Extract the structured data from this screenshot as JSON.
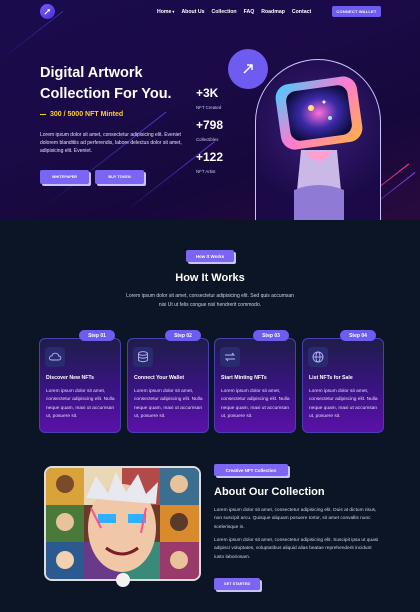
{
  "nav": {
    "links": [
      "Home",
      "About Us",
      "Collection",
      "FAQ",
      "Roadmap",
      "Contact"
    ],
    "connect_label": "CONNECT WALLET"
  },
  "hero": {
    "title": "Digital Artwork Collection For You.",
    "minted": "300 / 5000 NFT Minted",
    "description": "Lorem ipsum dolor sit amet, consectetur adipisicing elit. Eveniet dolorem blanditiis ad perferendis, labore delectus dolor sit amet, adipisicing elit. Eveniet.",
    "btn_whitepaper": "WHITEPAPER",
    "btn_buy": "BUY TOKEN",
    "stats": [
      {
        "value": "+3K",
        "label": "NFT Created"
      },
      {
        "value": "+798",
        "label": "Collectibles"
      },
      {
        "value": "+122",
        "label": "NFT Artist"
      }
    ]
  },
  "how": {
    "pill": "How It Works",
    "title": "How It Works",
    "description": "Lorem ipsum dolor sit amet, consectetur adipisicing elit. Sed quis accumsan nisi Ut ut felis congue nisl hendrerit commodo.",
    "steps": [
      {
        "step": "Step 01",
        "title": "Discover New NFTs",
        "icon": "cloud-icon",
        "desc": "Lorem ipsum dolor sit amet, consectetur adipiscing elit. Nulla neque quam, maxi ut accumsan ut, posuere sit."
      },
      {
        "step": "Step 02",
        "title": "Connect Your Wallet",
        "icon": "database-icon",
        "desc": "Lorem ipsum dolor sit amet, consectetur adipiscing elit. Nulla neque quam, maxi ut accumsan ut, posuere sit."
      },
      {
        "step": "Step 03",
        "title": "Start Minting NFTs",
        "icon": "exchange-icon",
        "desc": "Lorem ipsum dolor sit amet, consectetur adipiscing elit. Nulla neque quam, maxi ut accumsan ut, posuere sit."
      },
      {
        "step": "Step 04",
        "title": "List NFTs for Sale",
        "icon": "globe-icon",
        "desc": "Lorem ipsum dolor sit amet, consectetur adipiscing elit. Nulla neque quam, maxi ut accumsan ut, posuere sit."
      }
    ]
  },
  "about": {
    "pill": "Creative NFT Collection",
    "title": "About Our Collection",
    "p1": "Lorem ipsum dolor sit amet, consectetur adipisicing elit. Duis at dictum risus, non suscipit arcu. Quisque aliquam posuere tortor, sit amet convallis nunc scelerisque in.",
    "p2": "Lorem ipsum dolor sit amet, consectetur adipisicing elit. Suscipit ipsa ut quasi adipisci voluptates, voluptatibus aliquid alias beatae reprehenderit incidunt iusto laboriosam.",
    "btn": "GET STARTED"
  },
  "colors": {
    "accent": "#6e5cf0",
    "gold": "#ffcf2e",
    "bg": "#0b1526"
  }
}
